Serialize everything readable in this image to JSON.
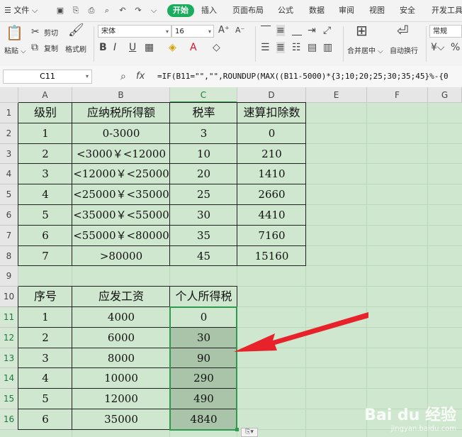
{
  "menu": {
    "file": "文件",
    "tabs": [
      "插入",
      "页面布局",
      "公式",
      "数据",
      "审阅",
      "视图",
      "安全",
      "开发工具"
    ],
    "active_tab": "开始"
  },
  "ribbon": {
    "paste": "粘贴",
    "cut": "剪切",
    "copy": "复制",
    "format_painter": "格式刷",
    "font_name": "宋体",
    "font_size": "16",
    "merge": "合并居中",
    "wrap": "自动换行",
    "number_format": "常规"
  },
  "formula_bar": {
    "name_box": "C11",
    "fx": "fx",
    "formula": "=IF(B11=\"\",\"\",ROUNDUP(MAX((B11-5000)*{3;10;20;25;30;35;45}%-{0"
  },
  "columns": [
    "A",
    "B",
    "C",
    "D",
    "E",
    "F",
    "G"
  ],
  "rows": [
    "1",
    "2",
    "3",
    "4",
    "5",
    "6",
    "7",
    "8",
    "9",
    "10",
    "11",
    "12",
    "13",
    "14",
    "15",
    "16"
  ],
  "tax_table": {
    "headers": [
      "级别",
      "应纳税所得额",
      "税率",
      "速算扣除数"
    ],
    "rows": [
      [
        "1",
        "0-3000",
        "3",
        "0"
      ],
      [
        "2",
        "<3000￥<12000",
        "10",
        "210"
      ],
      [
        "3",
        "<12000￥<25000",
        "20",
        "1410"
      ],
      [
        "4",
        "<25000￥<35000",
        "25",
        "2660"
      ],
      [
        "5",
        "<35000￥<55000",
        "30",
        "4410"
      ],
      [
        "6",
        "<55000￥<80000",
        "35",
        "7160"
      ],
      [
        "7",
        ">80000",
        "45",
        "15160"
      ]
    ]
  },
  "salary_table": {
    "headers": [
      "序号",
      "应发工资",
      "个人所得税"
    ],
    "rows": [
      [
        "1",
        "4000",
        "0"
      ],
      [
        "2",
        "6000",
        "30"
      ],
      [
        "3",
        "8000",
        "90"
      ],
      [
        "4",
        "10000",
        "290"
      ],
      [
        "5",
        "12000",
        "490"
      ],
      [
        "6",
        "35000",
        "4840"
      ]
    ]
  },
  "selection": {
    "active_cell": "C11",
    "range": "C11:C16"
  },
  "colors": {
    "accent": "#1aad5e",
    "sheet_bg": "#cfe6cf",
    "selection": "#2f9a4f",
    "arrow": "#e8222a"
  },
  "watermark": {
    "main": "Bai du 经验",
    "sub": "jingyan.baidu.com"
  }
}
